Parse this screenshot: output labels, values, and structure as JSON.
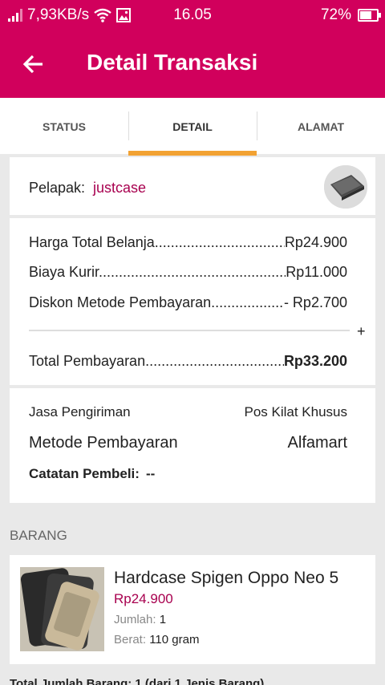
{
  "status_bar": {
    "speed": "7,93KB/s",
    "time": "16.05",
    "battery": "72%",
    "battery_level": 0.72
  },
  "app_bar": {
    "title": "Detail Transaksi"
  },
  "tabs": [
    {
      "label": "STATUS",
      "active": false
    },
    {
      "label": "DETAIL",
      "active": true
    },
    {
      "label": "ALAMAT",
      "active": false
    }
  ],
  "seller": {
    "label": "Pelapak:",
    "name": "justcase"
  },
  "costs": {
    "total_belanja": {
      "label": "Harga Total Belanja",
      "value": "Rp24.900"
    },
    "biaya_kurir": {
      "label": "Biaya Kurir",
      "value": "Rp11.000"
    },
    "diskon": {
      "label": "Diskon Metode Pembayaran",
      "value": "- Rp2.700"
    },
    "plus": "+",
    "total_pembayaran": {
      "label": "Total Pembayaran",
      "value": "Rp33.200"
    }
  },
  "shipping": {
    "jasa_label": "Jasa Pengiriman",
    "jasa_value": "Pos Kilat Khusus",
    "metode_label": "Metode Pembayaran",
    "metode_value": "Alfamart",
    "catatan_label": "Catatan Pembeli:",
    "catatan_value": "--"
  },
  "section_barang": "BARANG",
  "product": {
    "name": "Hardcase Spigen Oppo Neo 5",
    "price": "Rp24.900",
    "qty_label": "Jumlah:",
    "qty_value": "1",
    "weight_label": "Berat:",
    "weight_value": "110 gram"
  },
  "total_items": "Total Jumlah Barang: 1 (dari 1 Jenis Barang)",
  "colors": {
    "primary": "#d1005c",
    "accent": "#f2a233",
    "link": "#a8004f"
  }
}
